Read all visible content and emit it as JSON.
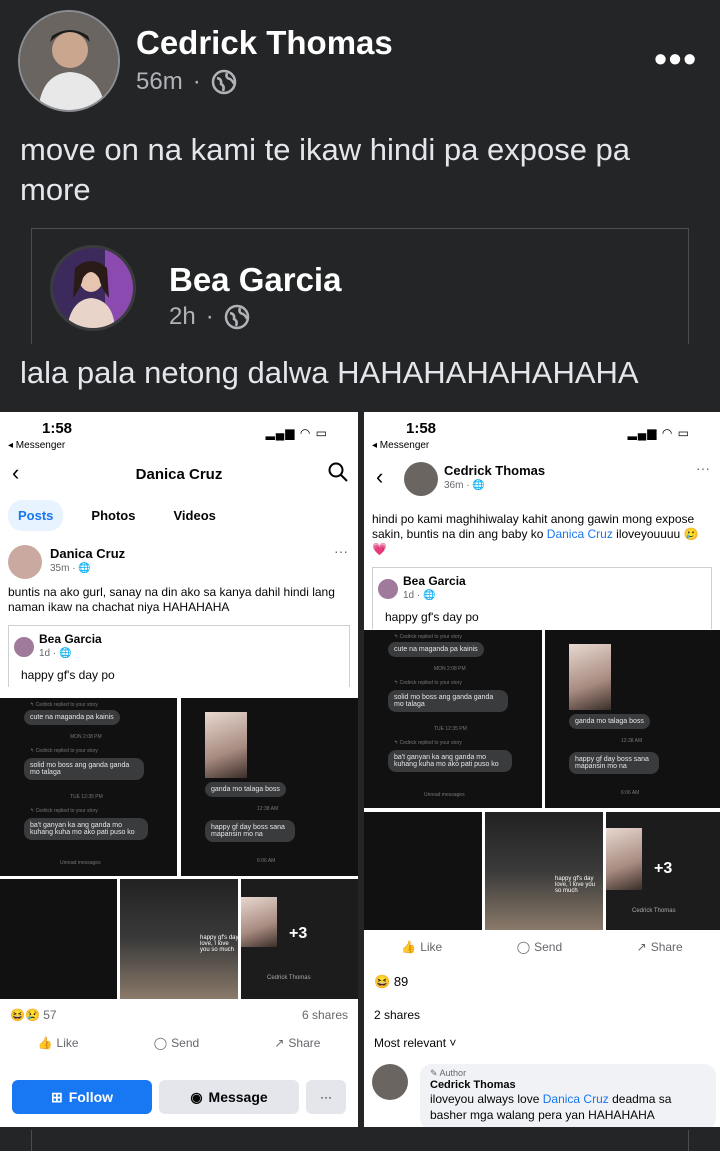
{
  "post": {
    "author": "Cedrick Thomas",
    "time": "56m",
    "text": "move on na kami te ikaw hindi pa expose pa more"
  },
  "shared": {
    "author": "Bea Garcia",
    "time": "2h",
    "text": "lala pala netong dalwa HAHAHAHAHAHAHA"
  },
  "left_shot": {
    "time": "1:58",
    "back_app": "◂ Messenger",
    "title": "Danica Cruz",
    "tabs": [
      "Posts",
      "Photos",
      "Videos"
    ],
    "author": "Danica Cruz",
    "meta": "35m · ",
    "text": "buntis na ako gurl, sanay na din ako sa kanya dahil hindi lang naman ikaw na chachat niya HAHAHAHA",
    "inner_author": "Bea Garcia",
    "inner_meta": "1d · ",
    "inner_text": "happy gf's day po",
    "chat": {
      "b1": "cute na maganda pa kainis",
      "b2": "solid mo boss ang ganda ganda mo talaga",
      "b3": "ba't ganyan ka ang ganda mo kuhang kuha mo ako pati puso ko",
      "b4": "ganda mo talaga boss",
      "b5": "happy gf day boss sana mapansin mo na",
      "t1": "MON 2:08 PM",
      "t2": "TUE 12:35 PM",
      "t3": "12:38 AM",
      "t4": "6:06 AM",
      "unread": "Unread messages",
      "reply": "↰ Cedrick replied to your story",
      "caption": "happy gf's day love, I love you so much",
      "sig": "Cedrick Thomas"
    },
    "plus": "+3",
    "reactions_count": "57",
    "shares": "6 shares",
    "like": "Like",
    "send": "Send",
    "share": "Share",
    "follow": "Follow",
    "message": "Message",
    "extra": "···"
  },
  "right_shot": {
    "time": "1:58",
    "back_app": "◂ Messenger",
    "author": "Cedrick Thomas",
    "meta": "36m · ",
    "text_before": "hindi po kami maghihiwalay kahit anong gawin mong expose sakin, buntis na din ang baby ko ",
    "text_link": "Danica Cruz",
    "text_after": " iloveyouuuu 🥲💗",
    "inner_author": "Bea Garcia",
    "inner_meta": "1d · ",
    "inner_text": "happy gf's day po",
    "plus": "+3",
    "like": "Like",
    "send": "Send",
    "share": "Share",
    "reactions_count": "89",
    "shares": "2 shares",
    "sort": "Most relevant ˅",
    "comment": {
      "tag": "✎ Author",
      "name": "Cedrick Thomas",
      "before": "iloveyou always love ",
      "link": "Danica Cruz",
      "after": " deadma sa basher mga walang pera yan HAHAHAHA"
    }
  },
  "colors": {
    "background": "#242526",
    "link": "#1877f2",
    "follow": "#1877f2"
  }
}
